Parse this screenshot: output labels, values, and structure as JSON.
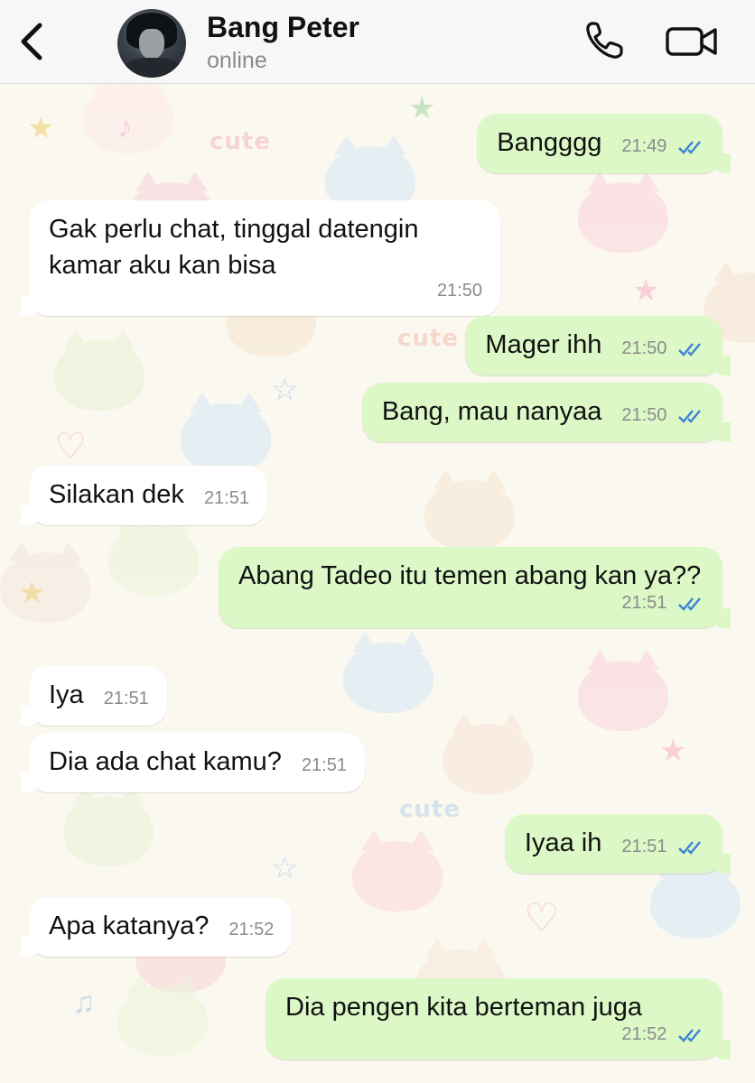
{
  "header": {
    "back_label": "",
    "contact_name": "Bang Peter",
    "status": "online",
    "icons": [
      "chevron-left-icon",
      "phone-icon",
      "video-camera-icon"
    ]
  },
  "colors": {
    "outgoing_bubble": "#dbf8c6",
    "incoming_bubble": "#ffffff",
    "read_ticks": "#3b82d6",
    "header_bg": "#f7f7f7"
  },
  "messages": [
    {
      "dir": "out",
      "text": "Bangggg",
      "time": "21:49",
      "read": true
    },
    {
      "dir": "in",
      "text": "Gak perlu chat, tinggal datengin kamar aku kan bisa",
      "time": "21:50"
    },
    {
      "dir": "out",
      "text": "Mager ihh",
      "time": "21:50",
      "read": true
    },
    {
      "dir": "out",
      "text": "Bang, mau nanyaa",
      "time": "21:50",
      "read": true
    },
    {
      "dir": "in",
      "text": "Silakan dek",
      "time": "21:51"
    },
    {
      "dir": "out",
      "text": "Abang Tadeo itu temen abang kan ya??",
      "time": "21:51",
      "read": true
    },
    {
      "dir": "in",
      "text": "Iya",
      "time": "21:51"
    },
    {
      "dir": "in",
      "text": "Dia ada chat kamu?",
      "time": "21:51"
    },
    {
      "dir": "out",
      "text": "Iyaa ih",
      "time": "21:51",
      "read": true
    },
    {
      "dir": "in",
      "text": "Apa katanya?",
      "time": "21:52"
    },
    {
      "dir": "out",
      "text": "Dia pengen kita berteman juga",
      "time": "21:52",
      "read": true
    }
  ],
  "wallpaper": {
    "labels": [
      "cute",
      "cute",
      "cute"
    ]
  }
}
